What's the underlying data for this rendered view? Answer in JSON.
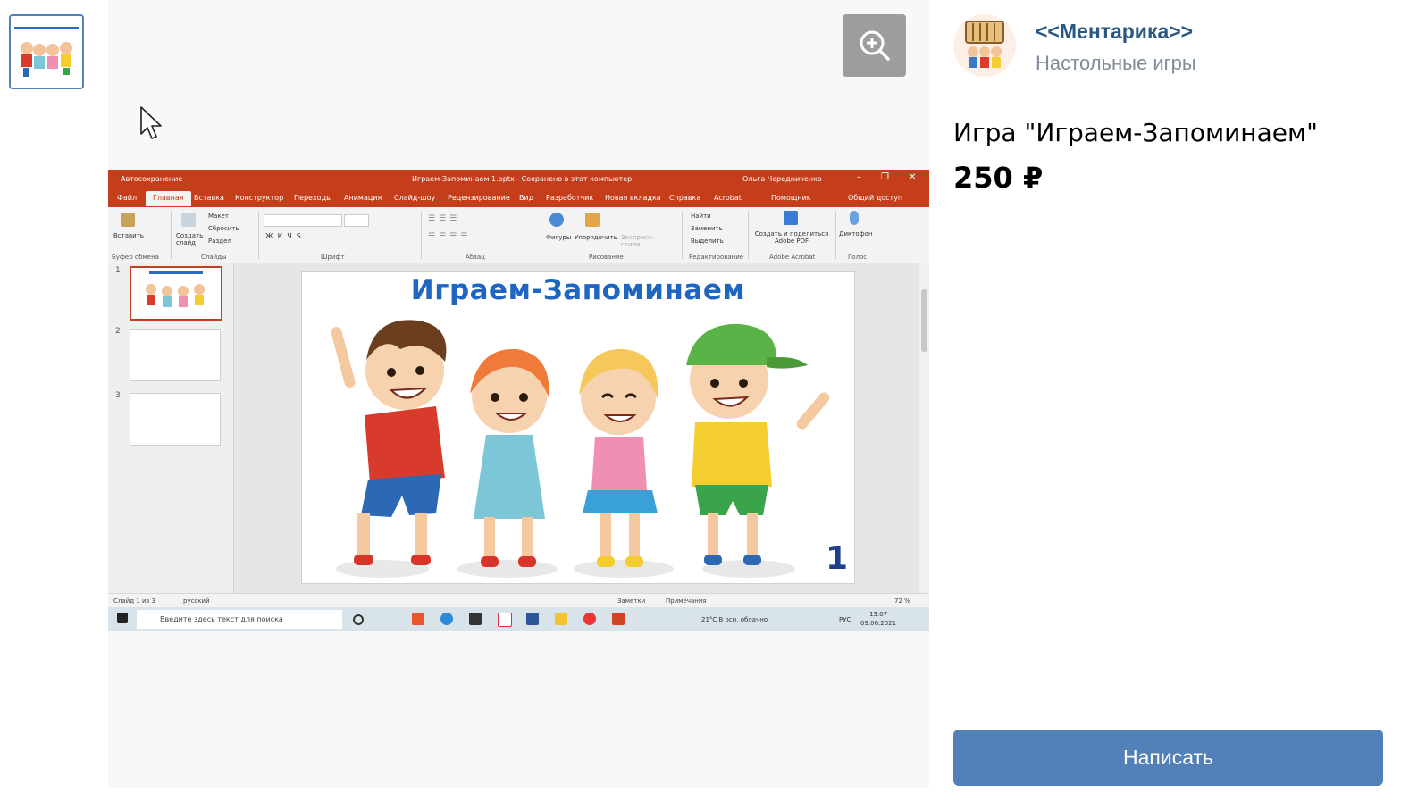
{
  "gallery": {
    "zoom_icon": "zoom-in-icon",
    "cursor_icon": "mouse-pointer-icon"
  },
  "powerpoint": {
    "autosave_label": "Автосохранение",
    "file_title": "Играем-Запоминаем 1.pptx - Сохранено в этот компьютер",
    "user_name": "Ольга Чередниченко",
    "tabs": [
      "Файл",
      "Главная",
      "Вставка",
      "Конструктор",
      "Переходы",
      "Анимация",
      "Слайд-шоу",
      "Рецензирование",
      "Вид",
      "Разработчик",
      "Новая вкладка",
      "Справка",
      "Acrobat",
      "Помощник",
      "Общий доступ"
    ],
    "ribbon": {
      "paste": "Вставить",
      "new_slide": "Создать слайд",
      "layout": "Макет",
      "reset": "Сбросить",
      "section": "Раздел",
      "shapes": "Фигуры",
      "arrange": "Упорядочить",
      "quick_styles": "Экспресс-стили",
      "find": "Найти",
      "replace": "Заменить",
      "select": "Выделить",
      "adobe_create": "Создать и поделиться Adobe PDF",
      "dictate": "Диктофон",
      "groups": [
        "Буфер обмена",
        "Слайды",
        "Шрифт",
        "Абзац",
        "Рисование",
        "Редактирование",
        "Adobe Acrobat",
        "Голос"
      ]
    },
    "slide_numbers": [
      "1",
      "2",
      "3"
    ],
    "slide_heading": "Играем-Запоминаем",
    "slide_page_number": "1",
    "status": {
      "slide_of": "Слайд 1 из 3",
      "language": "русский",
      "notes": "Заметки",
      "comments": "Примечания",
      "zoom": "72 %"
    }
  },
  "taskbar": {
    "search_placeholder": "Введите здесь текст для поиска",
    "weather": "21°C  В осн. облачно",
    "lang": "РУС",
    "time": "13:07",
    "date": "09.06.2021"
  },
  "shop": {
    "name": "<<Ментарика>>",
    "category": "Настольные игры"
  },
  "product": {
    "title": "Игра \"Играем-Запоминаем\"",
    "price": "250 ₽"
  },
  "actions": {
    "write_button": "Написать"
  },
  "colors": {
    "accent": "#5181b8",
    "link": "#2a5885",
    "powerpoint": "#c43e1c"
  }
}
